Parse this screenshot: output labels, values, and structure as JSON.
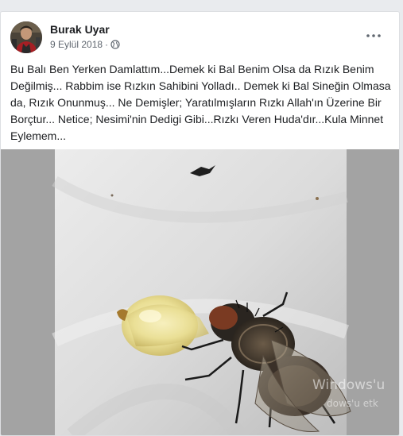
{
  "post": {
    "author": "Burak Uyar",
    "date": "9 Eylül 2018",
    "separator": "·",
    "privacy_icon": "globe-icon",
    "more_icon": "more-options-icon",
    "text": "Bu Balı Ben Yerken Damlattım...Demek ki Bal  Benim Olsa da Rızık Benim Değilmiş... Rabbim ise Rızkın Sahibini Yolladı.. Demek ki Bal Sineğin Olmasa da, Rızık Onunmuş... Ne Demişler; Yaratılmışların Rızkı Allah'ın Üzerine Bir Borçtur... Netice; Nesimi'nin Dedigi Gibi...Rızkı Veren Huda'dır...Kula Minnet Eylemem..."
  },
  "media": {
    "description_icon": "fly-on-honey-photo",
    "watermark_line1": "Windows'u",
    "watermark_line2": "dows'u etk"
  },
  "colors": {
    "text": "#1c1e21",
    "secondary": "#606770",
    "card_border": "#dddfe2",
    "page_bg": "#e9ebee"
  }
}
